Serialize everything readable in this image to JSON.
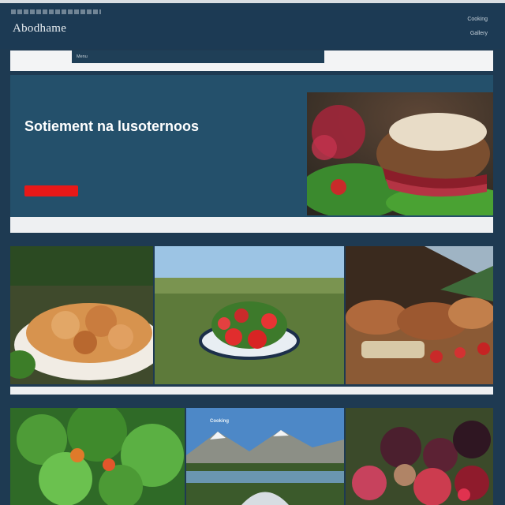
{
  "header": {
    "logo_text": "Abodhame",
    "top_links": [
      "Cooking",
      "Gallery"
    ]
  },
  "nav": {
    "left_label": "",
    "right_label": ""
  },
  "hero": {
    "kicker": "",
    "badge": "",
    "title": "Sotiement na lusoternoos",
    "line1": "",
    "line2": "",
    "line3": "",
    "button": ""
  },
  "gallery": {
    "row1": [
      {
        "label": ""
      },
      {
        "label": ""
      },
      {
        "label": ""
      }
    ],
    "row2": [
      {
        "label": ""
      },
      {
        "label": "Cooking"
      },
      {
        "label": ""
      }
    ]
  },
  "colors": {
    "accent": "#e81818",
    "page_bg": "#1e3a52",
    "hero_bg": "#24506b"
  }
}
